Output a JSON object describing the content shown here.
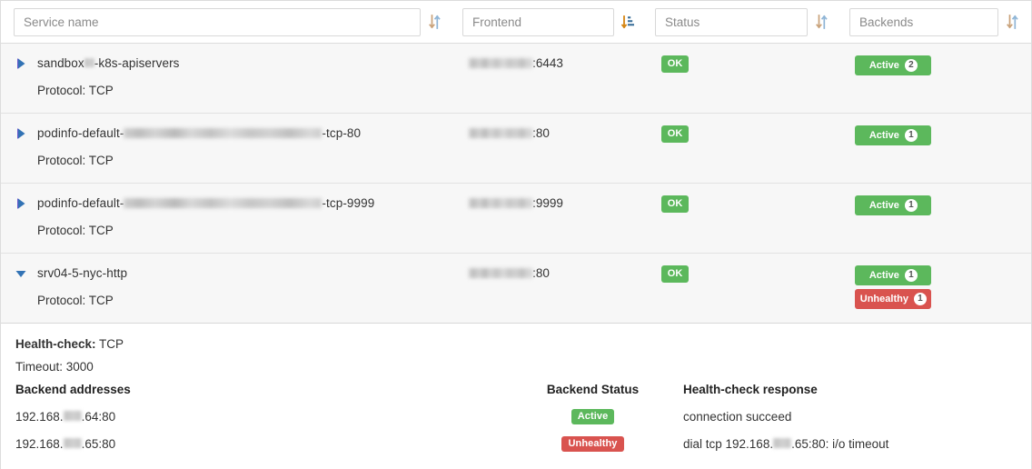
{
  "columns": [
    {
      "key": "service",
      "placeholder": "Service name",
      "sort_icon": "sort-unsorted-icon",
      "sort_active": false
    },
    {
      "key": "frontend",
      "placeholder": "Frontend",
      "sort_icon": "sort-amount-down-icon",
      "sort_active": true
    },
    {
      "key": "status",
      "placeholder": "Status",
      "sort_icon": "sort-unsorted-icon",
      "sort_active": false
    },
    {
      "key": "backends",
      "placeholder": "Backends",
      "sort_icon": "sort-unsorted-icon",
      "sort_active": false
    }
  ],
  "rows": [
    {
      "caret": "caret-right-icon",
      "expanded": false,
      "name_prefix": "sandbox",
      "name_suffix": "-k8s-apiservers",
      "redacted_mid": true,
      "protocol_label": "Protocol: TCP",
      "frontend_port": ":6443",
      "status_label": "OK",
      "backends": [
        {
          "label": "Active",
          "count": "2",
          "variant": "green"
        }
      ]
    },
    {
      "caret": "caret-right-icon",
      "expanded": false,
      "name_prefix": "podinfo-default-",
      "name_suffix": "-tcp-80",
      "redacted_mid": true,
      "protocol_label": "Protocol: TCP",
      "frontend_port": ":80",
      "status_label": "OK",
      "backends": [
        {
          "label": "Active",
          "count": "1",
          "variant": "green"
        }
      ]
    },
    {
      "caret": "caret-right-icon",
      "expanded": false,
      "name_prefix": "podinfo-default-",
      "name_suffix": "-tcp-9999",
      "redacted_mid": true,
      "protocol_label": "Protocol: TCP",
      "frontend_port": ":9999",
      "status_label": "OK",
      "backends": [
        {
          "label": "Active",
          "count": "1",
          "variant": "green"
        }
      ]
    },
    {
      "caret": "caret-down-icon",
      "expanded": true,
      "name_prefix": "srv04-5-nyc-http",
      "name_suffix": "",
      "redacted_mid": false,
      "protocol_label": "Protocol: TCP",
      "frontend_port": ":80",
      "status_label": "OK",
      "backends": [
        {
          "label": "Active",
          "count": "1",
          "variant": "green"
        },
        {
          "label": "Unhealthy",
          "count": "1",
          "variant": "red"
        }
      ]
    }
  ],
  "detail": {
    "healthcheck_label": "Health-check:",
    "healthcheck_value": "TCP",
    "timeout_line": "Timeout: 3000",
    "headers": {
      "addresses": "Backend addresses",
      "status": "Backend Status",
      "response": "Health-check response"
    },
    "backends": [
      {
        "addr_prefix": "192.168.",
        "addr_suffix": ".64:80",
        "status": "Active",
        "status_variant": "green",
        "response": "connection succeed"
      },
      {
        "addr_prefix": "192.168.",
        "addr_suffix": ".65:80",
        "status": "Unhealthy",
        "status_variant": "red",
        "response_prefix": "dial tcp 192.168.",
        "response_suffix": ".65:80: i/o timeout"
      }
    ]
  },
  "colors": {
    "ok_green": "#5cb85c",
    "unhealthy_red": "#d9534f",
    "caret_blue": "#3273b5",
    "sort_active_orange": "#d58512"
  }
}
